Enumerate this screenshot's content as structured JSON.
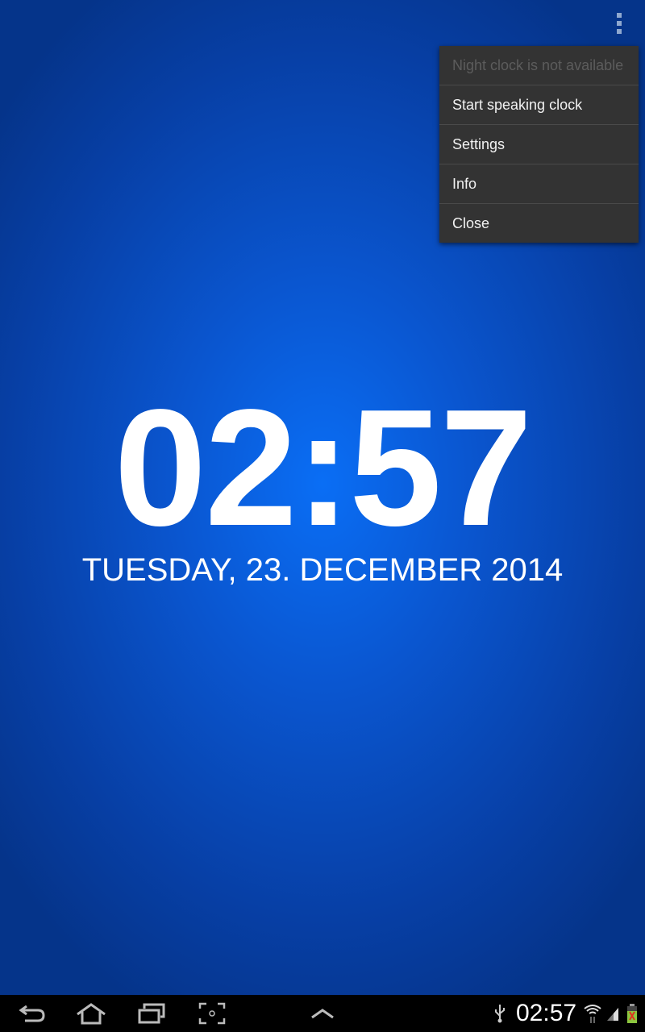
{
  "action_bar": {
    "overflow_icon": "overflow-menu-icon"
  },
  "menu": {
    "items": [
      {
        "label": "Night clock is not available",
        "enabled": false
      },
      {
        "label": "Start speaking clock",
        "enabled": true
      },
      {
        "label": "Settings",
        "enabled": true
      },
      {
        "label": "Info",
        "enabled": true
      },
      {
        "label": "Close",
        "enabled": true
      }
    ]
  },
  "clock": {
    "time": "02:57",
    "date": "TUESDAY, 23. DECEMBER 2014"
  },
  "system_bar": {
    "time": "02:57",
    "icons": [
      "back-icon",
      "home-icon",
      "recent-apps-icon",
      "screenshot-icon",
      "up-chevron-icon",
      "usb-icon",
      "wifi-icon",
      "signal-icon",
      "battery-icon"
    ]
  },
  "colors": {
    "background": "#0a56d0",
    "menu": "#333333",
    "text": "#ffffff"
  }
}
